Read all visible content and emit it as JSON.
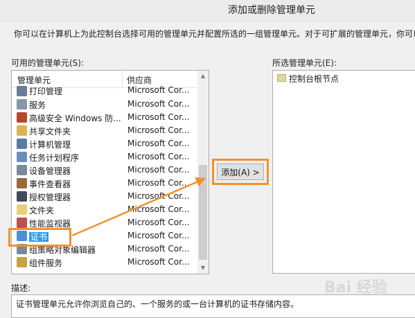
{
  "window": {
    "title": "添加或删除管理单元"
  },
  "intro_text": "你可以在计算机上为此控制台选择可用的管理单元并配置所选的一组管理单元。对于可扩展的管理单元，你可以",
  "available": {
    "label": "可用的管理单元(S):",
    "columns": [
      "管理单元",
      "供应商"
    ],
    "rows": [
      {
        "name": "打印管理",
        "vendor": "Microsoft Cor...",
        "icon": "printer-icon",
        "color": "#6b7d92"
      },
      {
        "name": "服务",
        "vendor": "Microsoft Cor...",
        "icon": "gears-icon",
        "color": "#8a96a8"
      },
      {
        "name": "高级安全 Windows 防...",
        "vendor": "Microsoft Cor...",
        "icon": "firewall-icon",
        "color": "#b5462e"
      },
      {
        "name": "共享文件夹",
        "vendor": "Microsoft Cor...",
        "icon": "shared-folder-icon",
        "color": "#d9b553"
      },
      {
        "name": "计算机管理",
        "vendor": "Microsoft Cor...",
        "icon": "computer-management-icon",
        "color": "#5a7ba8"
      },
      {
        "name": "任务计划程序",
        "vendor": "Microsoft Cor...",
        "icon": "clock-icon",
        "color": "#6a8fbf"
      },
      {
        "name": "设备管理器",
        "vendor": "Microsoft Cor...",
        "icon": "device-manager-icon",
        "color": "#7b8a9a"
      },
      {
        "name": "事件查看器",
        "vendor": "Microsoft Cor...",
        "icon": "event-viewer-icon",
        "color": "#9a6a3a"
      },
      {
        "name": "授权管理器",
        "vendor": "Microsoft Cor...",
        "icon": "authorization-icon",
        "color": "#404a5c"
      },
      {
        "name": "文件夹",
        "vendor": "Microsoft Cor...",
        "icon": "folder-icon",
        "color": "#e7cf76"
      },
      {
        "name": "性能监视器",
        "vendor": "Microsoft Cor...",
        "icon": "performance-icon",
        "color": "#c0504d"
      },
      {
        "name": "证书",
        "vendor": "Microsoft Cor...",
        "icon": "certificate-icon",
        "color": "#4a8fd6",
        "selected": true
      },
      {
        "name": "组策略对象编辑器",
        "vendor": "Microsoft Cor...",
        "icon": "policy-icon",
        "color": "#7a8a9a"
      },
      {
        "name": "组件服务",
        "vendor": "Microsoft Cor...",
        "icon": "component-services-icon",
        "color": "#c9a23a"
      }
    ]
  },
  "add_button": {
    "label": "添加(A) >"
  },
  "selected": {
    "label": "所选管理单元(E):",
    "items": [
      {
        "name": "控制台根节点",
        "icon": "folder-icon"
      }
    ]
  },
  "description": {
    "label": "描述:",
    "text": "证书管理单元允许你浏览自己的、一个服务的或一台计算机的证书存储内容。"
  },
  "watermark": "Bai 经验",
  "colors": {
    "highlight": "#f2912e",
    "selection": "#3399ff"
  }
}
